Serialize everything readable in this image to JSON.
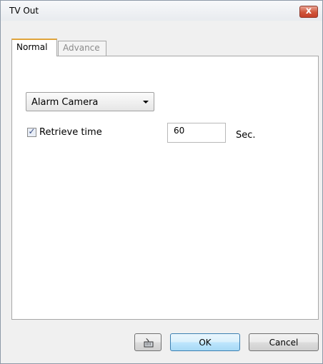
{
  "window": {
    "title": "TV Out",
    "close_label": "x"
  },
  "tabs": [
    {
      "label": "Normal",
      "active": true
    },
    {
      "label": "Advance",
      "active": false
    }
  ],
  "form": {
    "camera_select": {
      "value": "Alarm Camera"
    },
    "retrieve_time": {
      "label": "Retrieve time",
      "checked": true,
      "value": "60",
      "unit": "Sec."
    }
  },
  "buttons": {
    "keyboard_icon": "keyboard-icon",
    "ok": "OK",
    "cancel": "Cancel"
  },
  "colors": {
    "active_tab_accent": "#e0a43a",
    "close_button": "#c5402a",
    "default_button_border": "#3c7fb1"
  }
}
